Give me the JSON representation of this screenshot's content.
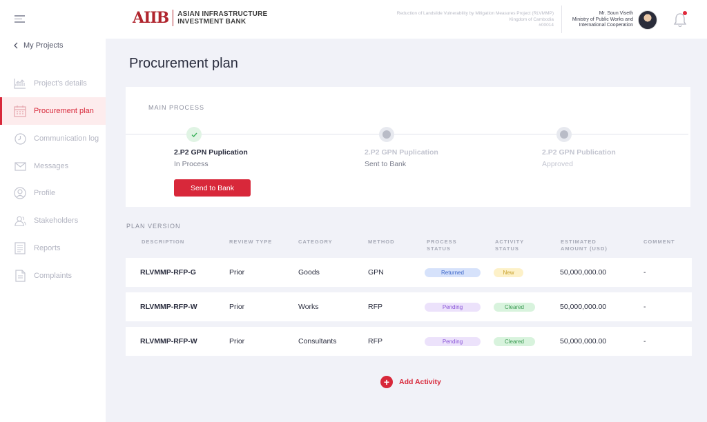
{
  "header": {
    "logo_mark": "AIIB",
    "logo_line1": "ASIAN INFRASTRUCTURE",
    "logo_line2": "INVESTMENT BANK",
    "project_line1": "Reduction of Landslide Vulnerability by Mitigation Measures Project (RLVMMP)",
    "project_line2": "Kingdom of Cambodia",
    "project_line3": "#00014",
    "user_name": "Mr. Soun Viseth",
    "user_org1": "Ministry of Public Works and",
    "user_org2": "International Cooperation"
  },
  "sidebar": {
    "back_label": "My Projects",
    "items": [
      {
        "label": "Project's details",
        "icon": "chart-icon"
      },
      {
        "label": "Procurement plan",
        "icon": "calendar-icon",
        "active": true
      },
      {
        "label": "Communication log",
        "icon": "clock-icon"
      },
      {
        "label": "Messages",
        "icon": "mail-icon"
      },
      {
        "label": "Profile",
        "icon": "user-icon"
      },
      {
        "label": "Stakeholders",
        "icon": "people-icon"
      },
      {
        "label": "Reports",
        "icon": "report-icon"
      },
      {
        "label": "Complaints",
        "icon": "document-icon"
      }
    ]
  },
  "main": {
    "title": "Procurement plan",
    "process": {
      "label": "MAIN PROCESS",
      "steps": [
        {
          "title": "2.P2 GPN Puplication",
          "status": "In Process",
          "state": "done"
        },
        {
          "title": "2.P2 GPN Puplication",
          "status": "Sent to Bank",
          "state": "pending"
        },
        {
          "title": "2.P2 GPN Publication",
          "status": "Approved",
          "state": "pending"
        }
      ],
      "button": "Send to Bank"
    },
    "plan": {
      "label": "PLAN VERSION",
      "headers": {
        "description": "DESCRIPTION",
        "review_type": "REVIEW TYPE",
        "category": "CATEGORY",
        "method": "METHOD",
        "process_status_1": "PROCESS",
        "process_status_2": "STATUS",
        "activity_status_1": "ACTIVITY",
        "activity_status_2": "STATUS",
        "amount_1": "ESTIMATED",
        "amount_2": "AMOUNT (USD)",
        "comment": "COMMENT"
      },
      "rows": [
        {
          "description": "RLVMMP-RFP-G",
          "review_type": "Prior",
          "category": "Goods",
          "method": "GPN",
          "process_status": "Returned",
          "activity_status": "New",
          "amount": "50,000,000.00",
          "comment": "-"
        },
        {
          "description": "RLVMMP-RFP-W",
          "review_type": "Prior",
          "category": "Works",
          "method": "RFP",
          "process_status": "Pending",
          "activity_status": "Cleared",
          "amount": "50,000,000.00",
          "comment": "-"
        },
        {
          "description": "RLVMMP-RFP-W",
          "review_type": "Prior",
          "category": "Consultants",
          "method": "RFP",
          "process_status": "Pending",
          "activity_status": "Cleared",
          "amount": "50,000,000.00",
          "comment": "-"
        }
      ]
    },
    "add_activity": "Add Activity"
  },
  "colors": {
    "accent": "#d8283a",
    "brand": "#b0252e",
    "returned_bg": "#d6e2fb",
    "returned_fg": "#3a64c8",
    "pending_bg": "#ece2fb",
    "pending_fg": "#8a55d8",
    "new_bg": "#fdf1c8",
    "new_fg": "#c8a02a",
    "cleared_bg": "#d8f3dd",
    "cleared_fg": "#3a9a52"
  }
}
